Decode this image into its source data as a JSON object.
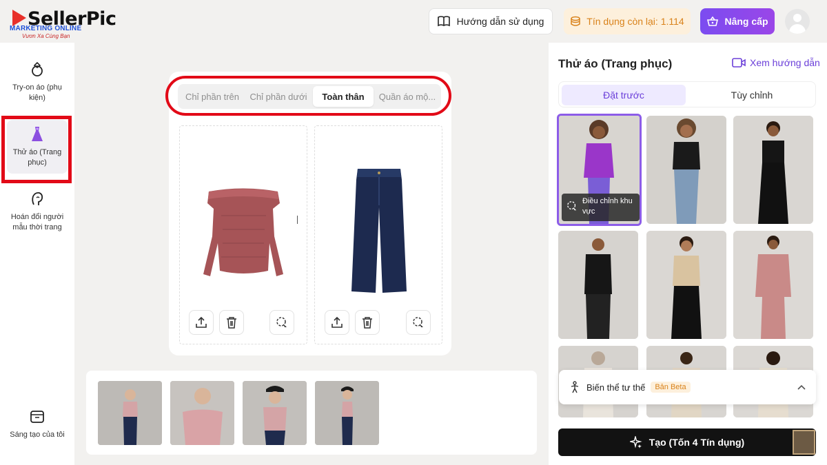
{
  "logo": {
    "brand": "SellerPic",
    "line1": "MARKETING ONLINE",
    "line2": "Vươn Xa Cùng Bạn"
  },
  "header": {
    "guide_label": "Hướng dẫn sử dụng",
    "credit_label": "Tín dụng còn lại: 1.114",
    "upgrade_label": "Nâng cấp"
  },
  "sidebar": {
    "items": [
      {
        "label": "Try-on áo (phụ kiện)",
        "icon": "ring-icon"
      },
      {
        "label": "Thử áo (Trang phục)",
        "icon": "dress-icon",
        "active": true
      },
      {
        "label": "Hoán đổi người mẫu thời trang",
        "icon": "face-swap-icon"
      },
      {
        "label": "Sáng tạo của tôi",
        "icon": "box-icon"
      }
    ]
  },
  "workspace": {
    "tabs": [
      {
        "label": "Chỉ phần trên"
      },
      {
        "label": "Chỉ phần dưới"
      },
      {
        "label": "Toàn thân",
        "active": true
      },
      {
        "label": "Quần áo mộ..."
      }
    ]
  },
  "right_panel": {
    "title": "Thử áo (Trang phục)",
    "tutorial_link": "Xem hướng dẫn",
    "segments": [
      {
        "label": "Đặt trước",
        "active": true
      },
      {
        "label": "Tùy chỉnh"
      }
    ],
    "adjust_chip": "Điều chỉnh khu vực",
    "pose_label": "Biến thể tư thế",
    "pose_badge": "Bản Beta",
    "create_label": "Tạo (Tốn 4 Tín dụng)"
  },
  "colors": {
    "accent": "#7b4cf0",
    "highlight_red": "#e20a17",
    "credit": "#d9821a"
  }
}
